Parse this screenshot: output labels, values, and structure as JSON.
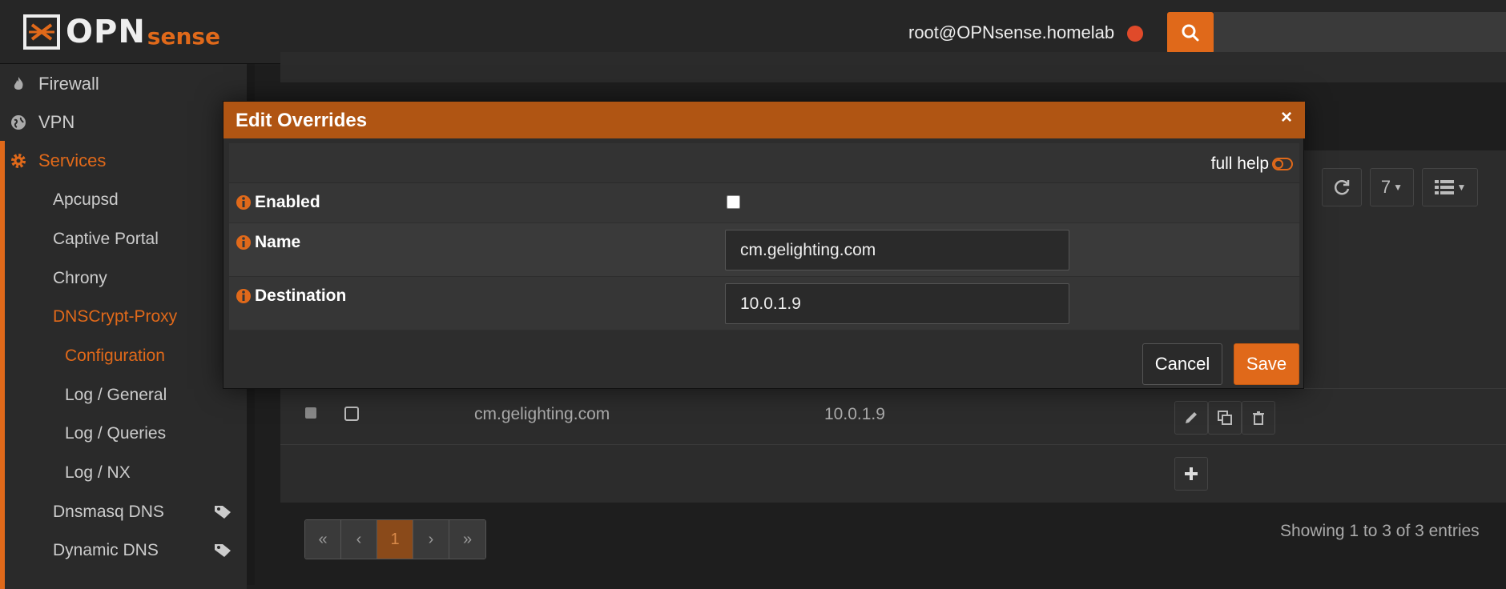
{
  "brand": {
    "word": "OPN",
    "suffix": "sense"
  },
  "header": {
    "user": "root@OPNsense.homelab",
    "status_color": "#e04a2a",
    "accent_color": "#e0691a"
  },
  "sidebar": {
    "top_items": [
      {
        "label": "Firewall",
        "icon": "fire-icon"
      },
      {
        "label": "VPN",
        "icon": "globe-icon"
      }
    ],
    "section": {
      "label": "Services",
      "icon": "gear-icon"
    },
    "items": [
      {
        "label": "Apcupsd"
      },
      {
        "label": "Captive Portal"
      },
      {
        "label": "Chrony"
      },
      {
        "label": "DNSCrypt-Proxy"
      },
      {
        "label": "Configuration"
      },
      {
        "label": "Log / General"
      },
      {
        "label": "Log / Queries"
      },
      {
        "label": "Log / NX"
      },
      {
        "label": "Dnsmasq DNS"
      },
      {
        "label": "Dynamic DNS"
      }
    ]
  },
  "grid": {
    "rows_per_page": "7",
    "row": {
      "name": "cm.gelighting.com",
      "destination": "10.0.1.9"
    },
    "pager": [
      "«",
      "‹",
      "1",
      "›",
      "»"
    ],
    "showing": "Showing 1 to 3 of 3 entries"
  },
  "modal": {
    "title": "Edit Overrides",
    "close": "×",
    "full_help": "full help",
    "fields": {
      "enabled_label": "Enabled",
      "enabled_checked": false,
      "name_label": "Name",
      "name_value": "cm.gelighting.com",
      "destination_label": "Destination",
      "destination_value": "10.0.1.9"
    },
    "cancel": "Cancel",
    "save": "Save"
  }
}
